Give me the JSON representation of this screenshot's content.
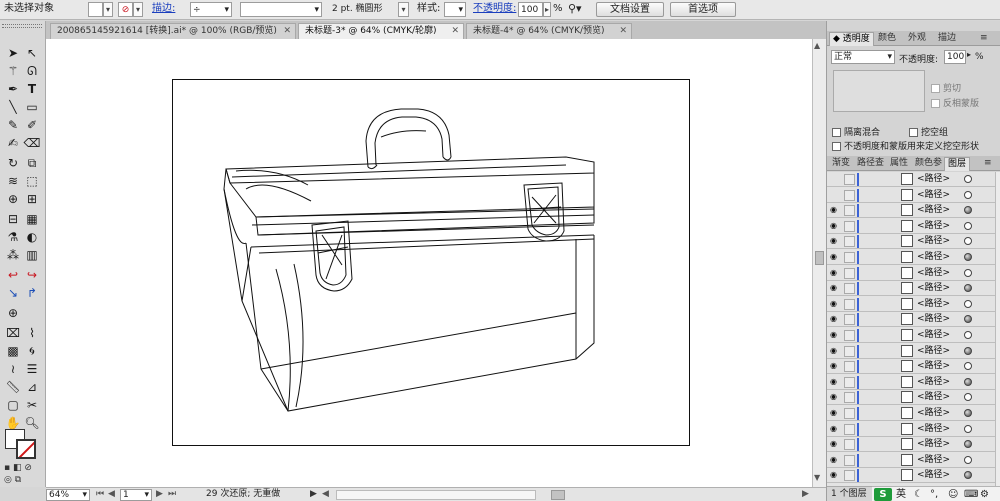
{
  "control_bar": {
    "selection_status": "未选择对象",
    "stroke_label": "描边:",
    "stroke_weight": "2 pt. 椭圆形",
    "style_label": "样式:",
    "opacity_label": "不透明度:",
    "opacity_value": "100",
    "percent": "%",
    "doc_setup_button": "文档设置",
    "preferences_button": "首选项"
  },
  "tabs": [
    {
      "label": "200865145921614 [转换].ai* @ 100% (RGB/预览)"
    },
    {
      "label": "未标题-3* @ 64% (CMYK/轮廓)"
    },
    {
      "label": "未标题-4* @ 64% (CMYK/预览)"
    }
  ],
  "transparency_panel": {
    "tabs": [
      "透明度",
      "颜色",
      "外观",
      "描边"
    ],
    "blend_mode": "正常",
    "opacity_label": "不透明度:",
    "opacity_value": "100",
    "percent": "%",
    "clip_label": "剪切",
    "invert_mask_label": "反相蒙版",
    "isolate_blending_label": "隔离混合",
    "knockout_group_label": "挖空组",
    "opacity_mask_label": "不透明度和蒙版用来定义挖空形状"
  },
  "layers_panel": {
    "tabs": [
      "渐变",
      "路径查",
      "属性",
      "颜色参",
      "图层"
    ],
    "rows": [
      {
        "name": "<路径>",
        "visible": false,
        "target_filled": false
      },
      {
        "name": "<路径>",
        "visible": false,
        "target_filled": false
      },
      {
        "name": "<路径>",
        "visible": true,
        "target_filled": true
      },
      {
        "name": "<路径>",
        "visible": true,
        "target_filled": false
      },
      {
        "name": "<路径>",
        "visible": true,
        "target_filled": false
      },
      {
        "name": "<路径>",
        "visible": true,
        "target_filled": true
      },
      {
        "name": "<路径>",
        "visible": true,
        "target_filled": false
      },
      {
        "name": "<路径>",
        "visible": true,
        "target_filled": true
      },
      {
        "name": "<路径>",
        "visible": true,
        "target_filled": false
      },
      {
        "name": "<路径>",
        "visible": true,
        "target_filled": true
      },
      {
        "name": "<路径>",
        "visible": true,
        "target_filled": false
      },
      {
        "name": "<路径>",
        "visible": true,
        "target_filled": true
      },
      {
        "name": "<路径>",
        "visible": true,
        "target_filled": false
      },
      {
        "name": "<路径>",
        "visible": true,
        "target_filled": true
      },
      {
        "name": "<路径>",
        "visible": true,
        "target_filled": false
      },
      {
        "name": "<路径>",
        "visible": true,
        "target_filled": true
      },
      {
        "name": "<路径>",
        "visible": true,
        "target_filled": false
      },
      {
        "name": "<路径>",
        "visible": true,
        "target_filled": true
      },
      {
        "name": "<路径>",
        "visible": true,
        "target_filled": false
      },
      {
        "name": "<路径>",
        "visible": true,
        "target_filled": true
      }
    ],
    "footer_label": "1 个图层"
  },
  "status_bar": {
    "zoom": "64%",
    "page": "1",
    "status_text": "29 次还原; 无重做"
  },
  "tray": {
    "ime_label": "英"
  }
}
